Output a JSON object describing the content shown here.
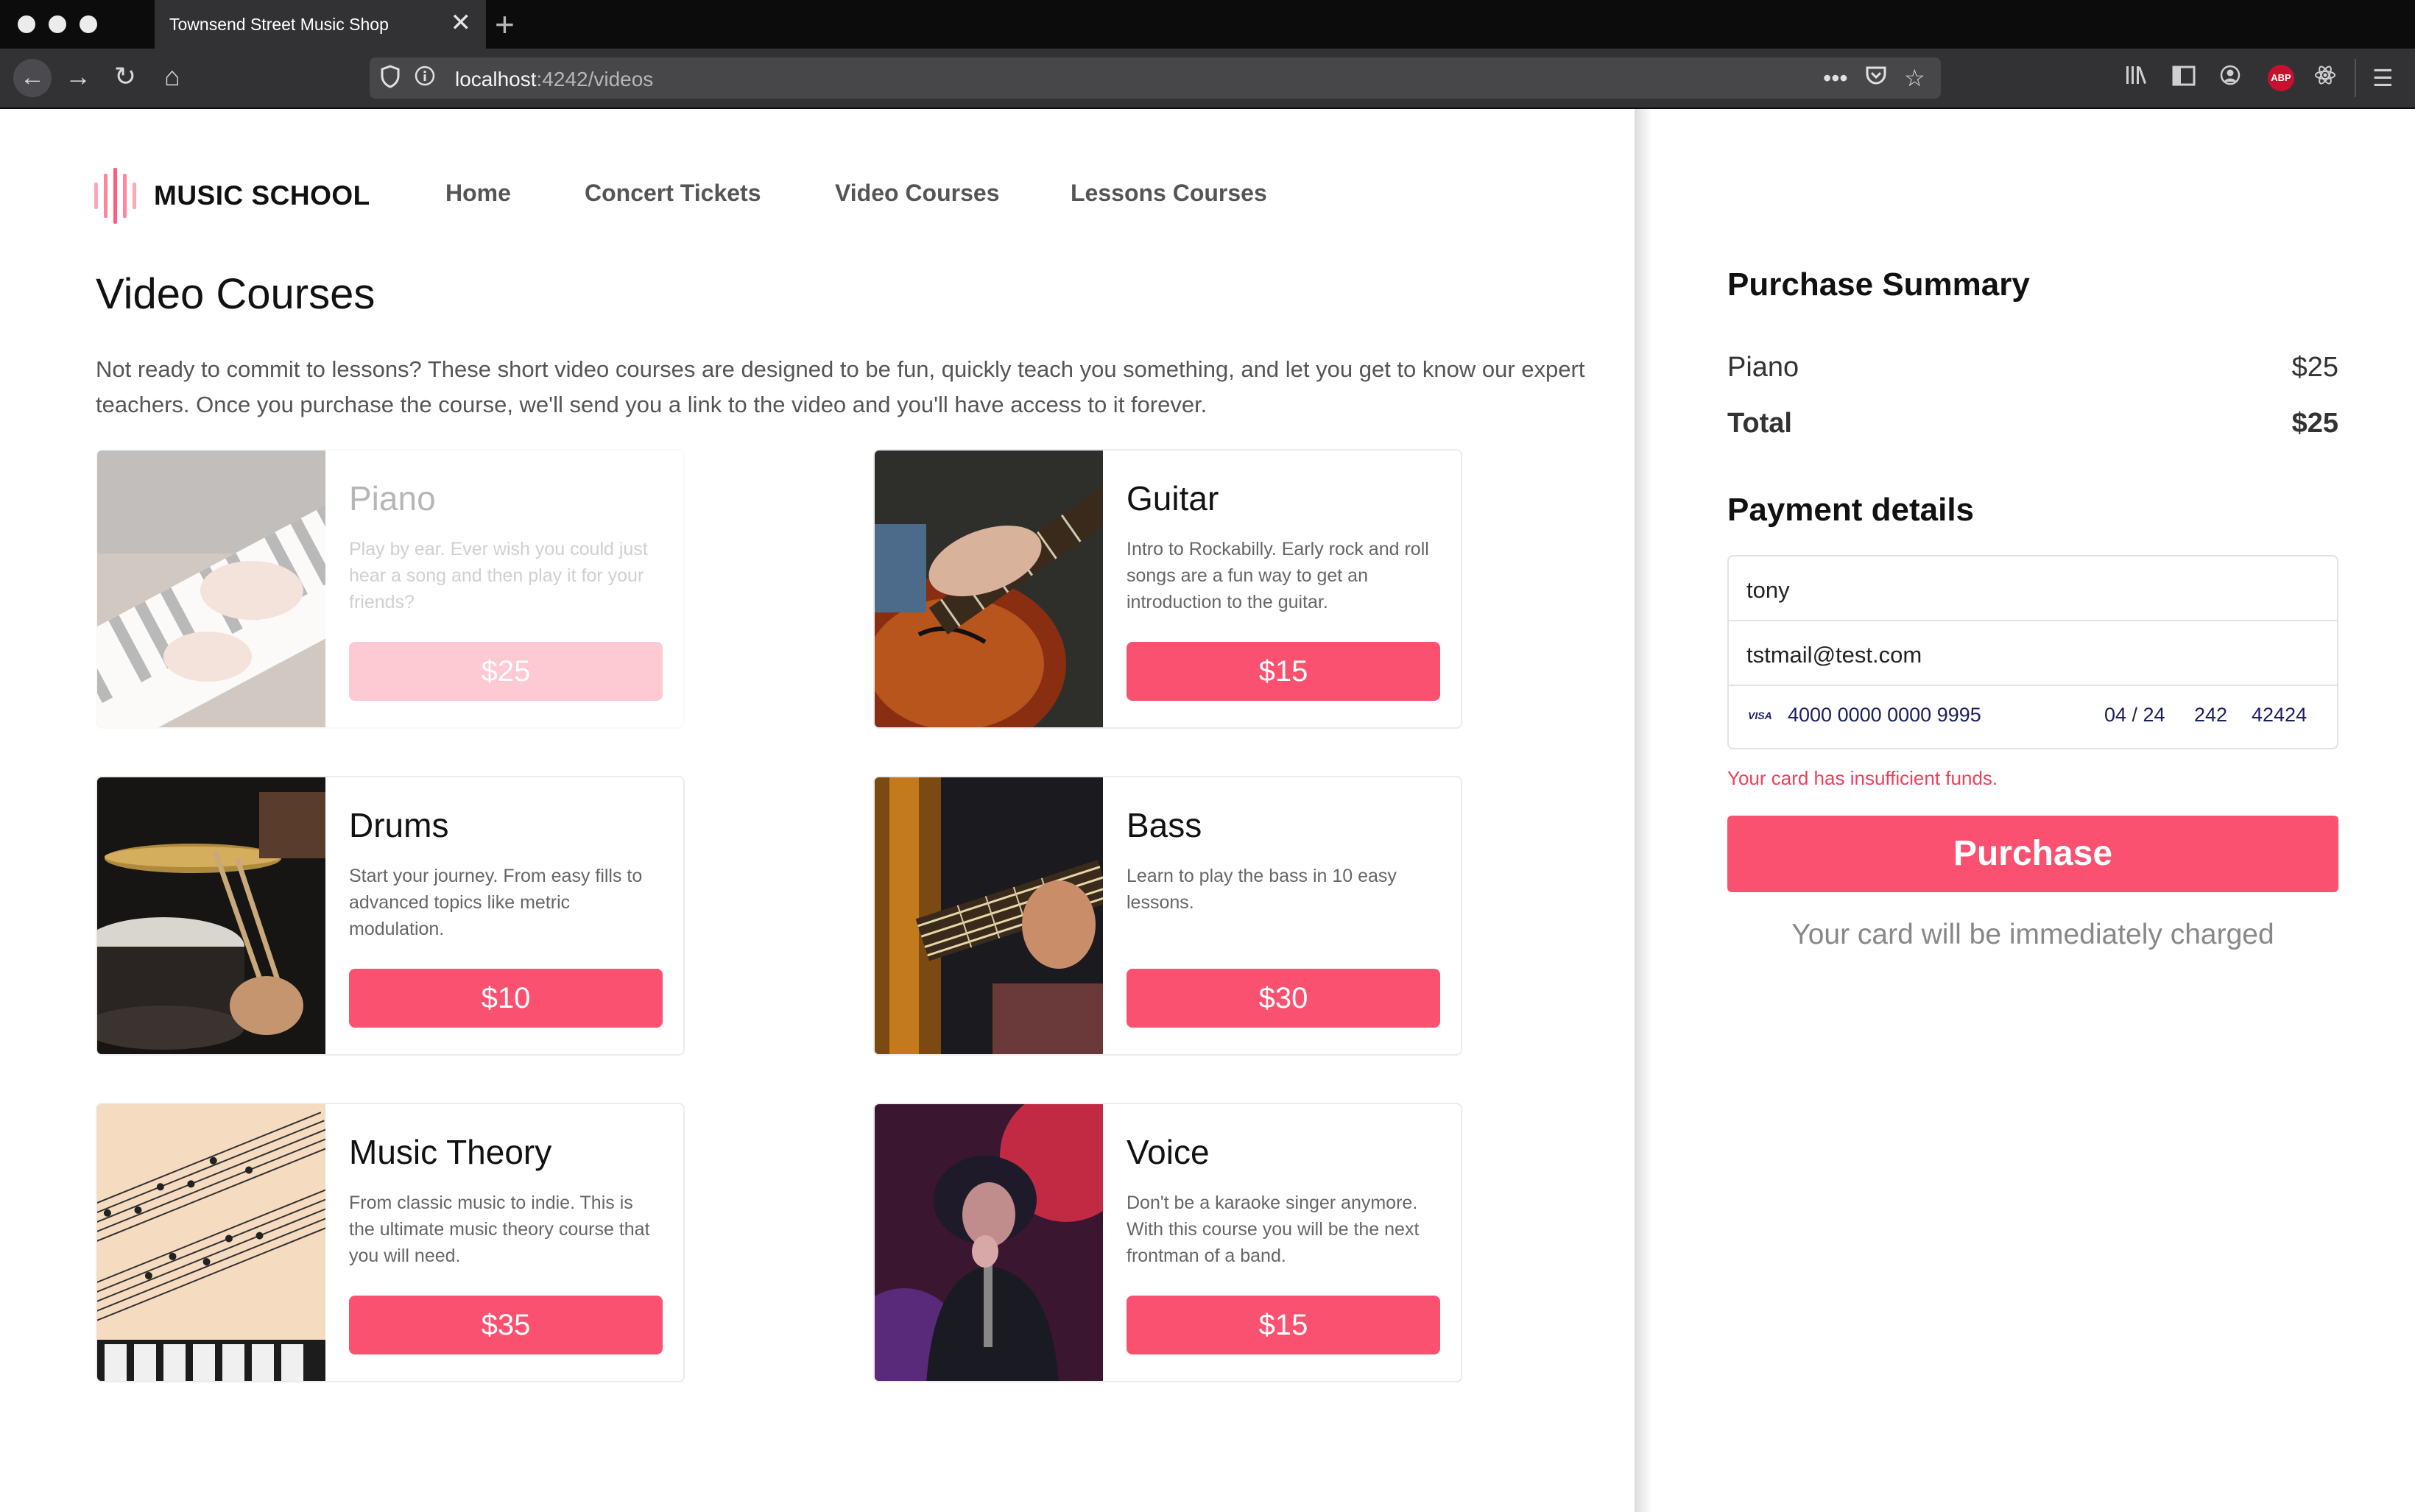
{
  "browser": {
    "tab_title": "Townsend Street Music Shop",
    "tab_close": "✕",
    "new_tab": "+",
    "url_host": "localhost",
    "url_rest": ":4242/videos",
    "abp_label": "ABP"
  },
  "site": {
    "brand": "MUSIC SCHOOL",
    "nav": [
      "Home",
      "Concert Tickets",
      "Video Courses",
      "Lessons Courses"
    ],
    "accent_color": "#fb5170"
  },
  "main": {
    "title": "Video Courses",
    "intro": "Not ready to commit to lessons? These short video courses are designed to be fun, quickly teach you something, and let you get to know our expert teachers. Once you purchase the course, we'll send you a link to the video and you'll have access to it forever.",
    "courses": [
      {
        "name": "Piano",
        "description": "Play by ear. Ever wish you could just hear a song and then play it for your friends?",
        "price": "$25",
        "state": "selected"
      },
      {
        "name": "Guitar",
        "description": "Intro to Rockabilly. Early rock and roll songs are a fun way to get an introduction to the guitar.",
        "price": "$15"
      },
      {
        "name": "Drums",
        "description": "Start your journey. From easy fills to advanced topics like metric modulation.",
        "price": "$10"
      },
      {
        "name": "Bass",
        "description": "Learn to play the bass in 10 easy lessons.",
        "price": "$30"
      },
      {
        "name": "Music Theory",
        "description": "From classic music to indie. This is the ultimate music theory course that you will need.",
        "price": "$35"
      },
      {
        "name": "Voice",
        "description": "Don't be a karaoke singer anymore. With this course you will be the next frontman of a band.",
        "price": "$15"
      }
    ]
  },
  "summary": {
    "title": "Purchase Summary",
    "item_name": "Piano",
    "item_price": "$25",
    "total_label": "Total",
    "total_price": "$25",
    "payment_title": "Payment details",
    "name_value": "tony",
    "email_value": "tstmail@test.com",
    "card_brand": "VISA",
    "card_number": "4000 0000 0000 9995",
    "card_expiry": "04 / 24",
    "card_cvc": "242",
    "card_zip": "42424",
    "error": "Your card has insufficient funds.",
    "purchase_label": "Purchase",
    "charge_note": "Your card will be immediately charged"
  }
}
